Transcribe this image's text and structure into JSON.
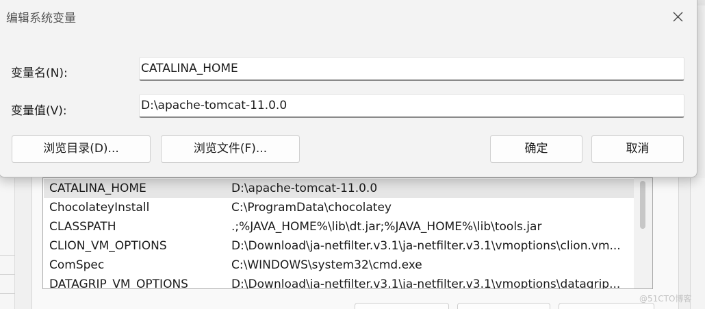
{
  "dialog": {
    "title": "编辑系统变量",
    "name_label": "变量名(N):",
    "name_value": "CATALINA_HOME",
    "value_label": "变量值(V):",
    "value_value": "D:\\apache-tomcat-11.0.0",
    "browse_dir_label": "浏览目录(D)...",
    "browse_file_label": "浏览文件(F)...",
    "ok_label": "确定",
    "cancel_label": "取消"
  },
  "system_variables": {
    "rows": [
      {
        "name": "CATALINA_HOME",
        "value": "D:\\apache-tomcat-11.0.0",
        "selected": true
      },
      {
        "name": "ChocolateyInstall",
        "value": "C:\\ProgramData\\chocolatey"
      },
      {
        "name": "CLASSPATH",
        "value": ".;%JAVA_HOME%\\lib\\dt.jar;%JAVA_HOME%\\lib\\tools.jar"
      },
      {
        "name": "CLION_VM_OPTIONS",
        "value": "D:\\Download\\ja-netfilter.v3.1\\ja-netfilter.v3.1\\vmoptions\\clion.vm..."
      },
      {
        "name": "ComSpec",
        "value": "C:\\WINDOWS\\system32\\cmd.exe"
      },
      {
        "name": "DATAGRIP_VM_OPTIONS",
        "value": "D:\\Download\\ja-netfilter.v3.1\\ja-netfilter.v3.1\\vmoptions\\datagrip..."
      }
    ]
  },
  "watermark": "@51CTO博客",
  "icons": {
    "close": "close-icon"
  }
}
